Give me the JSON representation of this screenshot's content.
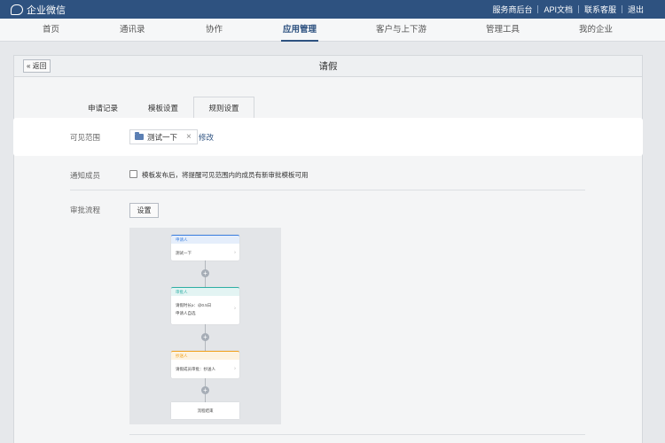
{
  "topbar": {
    "app_name": "企业微信",
    "links": [
      "服务商后台",
      "API文档",
      "联系客服",
      "退出"
    ]
  },
  "nav": {
    "items": [
      "首页",
      "通讯录",
      "协作",
      "应用管理",
      "客户与上下游",
      "管理工具",
      "我的企业"
    ],
    "active": "应用管理"
  },
  "panel": {
    "back_label": "« 返回",
    "title": "请假",
    "tabs": [
      "申请记录",
      "模板设置",
      "规则设置"
    ],
    "active_tab": "规则设置"
  },
  "visible_scope": {
    "label": "可见范围",
    "chip_text": "测试一下",
    "close_symbol": "×",
    "edit_label": "修改"
  },
  "notify": {
    "label": "通知成员",
    "checkbox_text": "模板发布后，将提醒可见范围内的成员有新审批模板可用",
    "checked": false
  },
  "approval_flow": {
    "label": "审批流程",
    "button_label": "设置",
    "nodes": [
      {
        "title": "申请人",
        "lines": [
          "测试一下"
        ],
        "color": "#3b7fe0"
      },
      {
        "title": "审批人",
        "lines": [
          "请假时长≥：@0.5日",
          "申请人自选"
        ],
        "color": "#2fb0a6"
      },
      {
        "title": "抄送人",
        "lines": [
          "请假成员审批：抄送人"
        ],
        "color": "#f0a21e"
      }
    ],
    "end_label": "流程结束"
  },
  "colors": {
    "brand": "#2e5280",
    "highlight_bg": "#ffffff"
  }
}
